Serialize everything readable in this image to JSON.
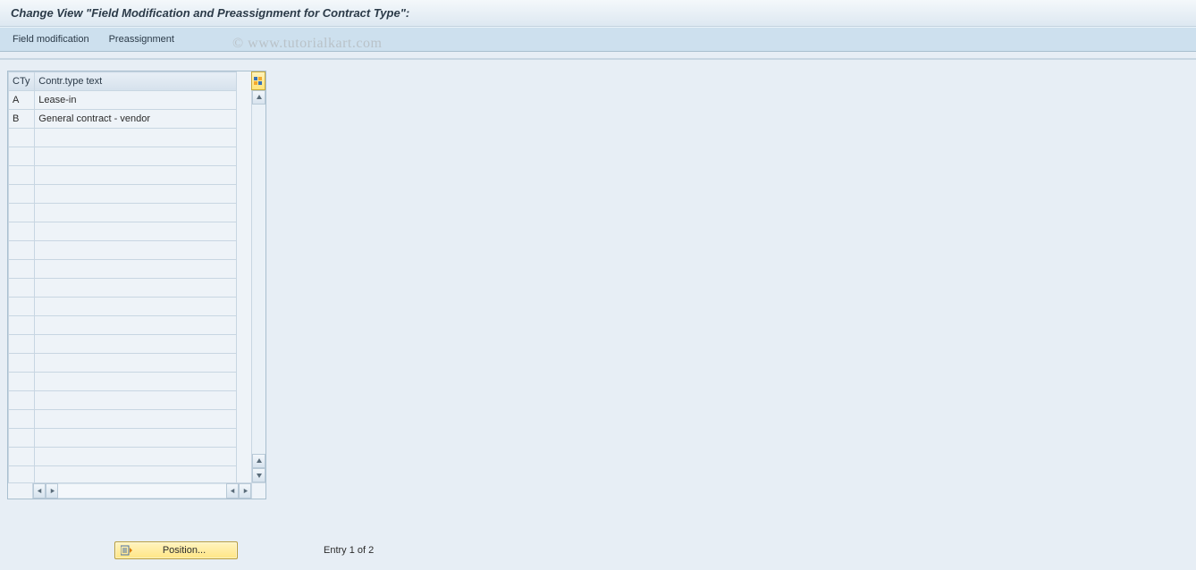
{
  "title": "Change View \"Field Modification and Preassignment for Contract Type\":",
  "toolbar": {
    "field_modification": "Field modification",
    "preassignment": "Preassignment"
  },
  "watermark": "© www.tutorialkart.com",
  "table": {
    "headers": {
      "cty": "CTy",
      "text": "Contr.type text"
    },
    "rows": [
      {
        "cty": "A",
        "text": "Lease-in"
      },
      {
        "cty": "B",
        "text": "General contract - vendor"
      }
    ],
    "empty_row_count": 19
  },
  "footer": {
    "position_label": "Position...",
    "entry_status": "Entry 1 of 2"
  }
}
